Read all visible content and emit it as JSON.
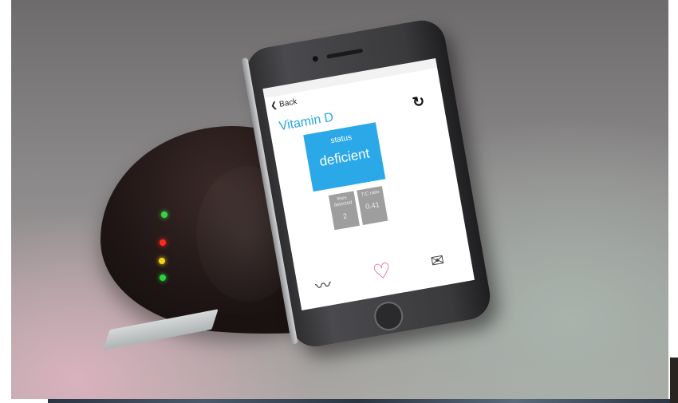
{
  "app": {
    "back_label": "Back",
    "title": "Vitamin D",
    "status_label": "status",
    "status_value": "deficient",
    "lines_label": "lines detected",
    "lines_value": "2",
    "ratio_label": "T/C ratio",
    "ratio_value": "0.41"
  },
  "icons": {
    "refresh": "refresh-icon",
    "signal": "signal-icon",
    "heart": "heart-icon",
    "mail": "mail-icon"
  },
  "colors": {
    "accent_blue": "#2aa8e8",
    "heart_red": "#e8496c",
    "led_green": "#39d34a",
    "led_red": "#ff2a1f",
    "led_yellow": "#f0d21a"
  }
}
